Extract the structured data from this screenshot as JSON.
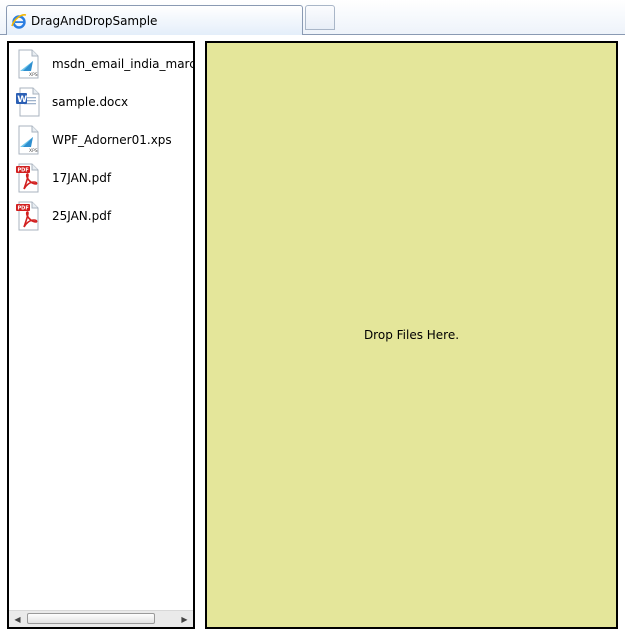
{
  "window": {
    "tab_title": "DragAndDropSample",
    "tab_icon": "internet-explorer-icon",
    "new_tab_icon": "new-tab-button"
  },
  "file_list": {
    "items": [
      {
        "name": "msdn_email_india_march",
        "icon": "xps-file-icon"
      },
      {
        "name": "sample.docx",
        "icon": "word-document-icon"
      },
      {
        "name": "WPF_Adorner01.xps",
        "icon": "xps-file-icon"
      },
      {
        "name": "17JAN.pdf",
        "icon": "pdf-file-icon"
      },
      {
        "name": "25JAN.pdf",
        "icon": "pdf-file-icon"
      }
    ]
  },
  "drop_zone": {
    "label": "Drop Files Here.",
    "background": "#e4e69a"
  },
  "colors": {
    "border": "#000000",
    "tab_border": "#8a9ab3",
    "pdf_red": "#d21f1f"
  }
}
